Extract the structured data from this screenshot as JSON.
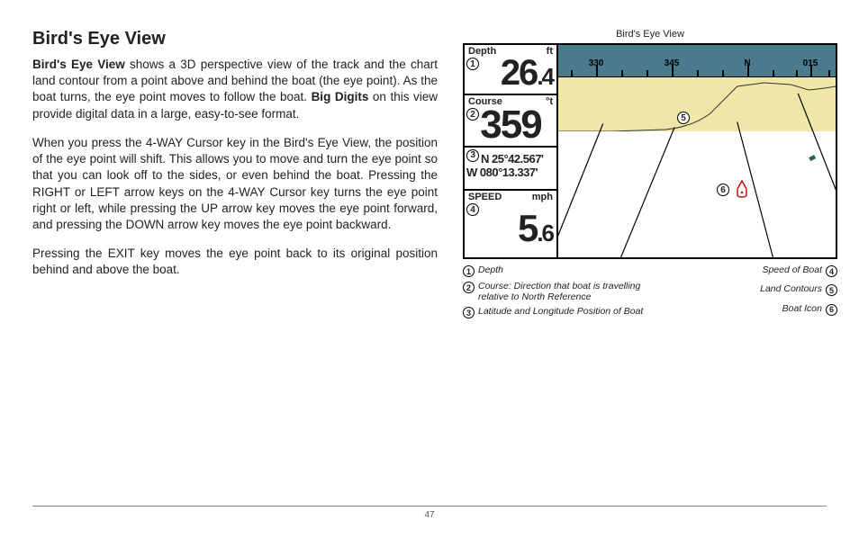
{
  "title": "Bird's Eye View",
  "para1_lead": "Bird's Eye View",
  "para1_rest": " shows a 3D perspective view of the track and the chart land contour from a point above and behind the boat (the eye point). As the boat turns, the eye point moves to follow the boat. ",
  "para1_bold2": "Big Digits",
  "para1_rest2": " on this view provide digital data in a large, easy-to-see format.",
  "para2": "When you press the 4-WAY Cursor key in the Bird's Eye View, the position of the eye point will shift. This allows you to move and turn the eye point so that you can look off to the sides, or even behind the boat. Pressing the RIGHT or LEFT arrow keys on the 4-WAY Cursor key turns the eye point right or left, while pressing the UP arrow key moves the eye point forward, and pressing the DOWN arrow key moves the eye point backward.",
  "para3": "Pressing the EXIT key moves the eye point back to its original position behind and above the boat.",
  "fig_title": "Bird's Eye View",
  "depth_label": "Depth",
  "depth_unit": "ft",
  "depth_value": "26",
  "depth_dec": ".4",
  "course_label": "Course",
  "course_unit": "°t",
  "course_value": "359",
  "lat": "N 25°42.567'",
  "lon": "W 080°13.337'",
  "speed_label": "SPEED",
  "speed_unit": "mph",
  "speed_value": "5",
  "speed_dec": ".6",
  "compass_330": "330",
  "compass_345": "345",
  "compass_N": "N",
  "compass_015": "015",
  "legend": {
    "l1": "Depth",
    "l2": "Course: Direction that boat is travelling relative to North Reference",
    "l3": "Latitude and Longitude Position of Boat",
    "l4": "Speed of Boat",
    "l5": "Land Contours",
    "l6": "Boat Icon"
  },
  "page_number": "47"
}
